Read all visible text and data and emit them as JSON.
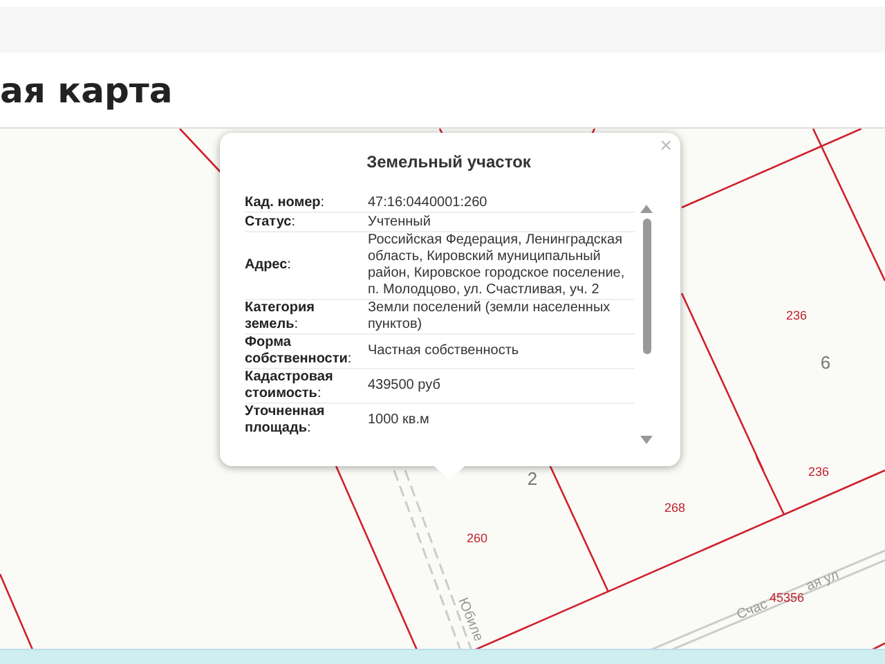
{
  "header": {
    "title": "ая карта"
  },
  "map": {
    "labels": [
      {
        "text": "236",
        "kind": "number"
      },
      {
        "text": "6",
        "kind": "block"
      },
      {
        "text": "236",
        "kind": "number"
      },
      {
        "text": "2",
        "kind": "block"
      },
      {
        "text": "268",
        "kind": "number"
      },
      {
        "text": "260",
        "kind": "number"
      },
      {
        "text": "Счас",
        "kind": "street"
      },
      {
        "text": "45356",
        "kind": "number"
      },
      {
        "text": "ая ул",
        "kind": "street"
      },
      {
        "text": "Юбиле",
        "kind": "street"
      }
    ]
  },
  "popup": {
    "title": "Земельный участок",
    "close": "×",
    "rows": [
      {
        "label": "**Кад. номер**:",
        "value": "47:16:0440001:260"
      },
      {
        "label": "**Статус**:",
        "value": "Учтенный"
      },
      {
        "label": "**Адрес**:",
        "value": "Российская Федерация, Ленинградская область, Кировский муниципальный район, Кировское городское поселение, п. Молодцово, ул. Счастливая, уч. 2"
      },
      {
        "label": "**Категория земель**:",
        "value": "Земли поселений (земли населенных пунктов)"
      },
      {
        "label": "**Форма собственности**:",
        "value": "Частная собственность"
      },
      {
        "label": "**Кадастровая стоимость**:",
        "value": "439500 руб"
      },
      {
        "label": "**Уточненная площадь**:",
        "value": "1000 кв.м"
      }
    ]
  }
}
